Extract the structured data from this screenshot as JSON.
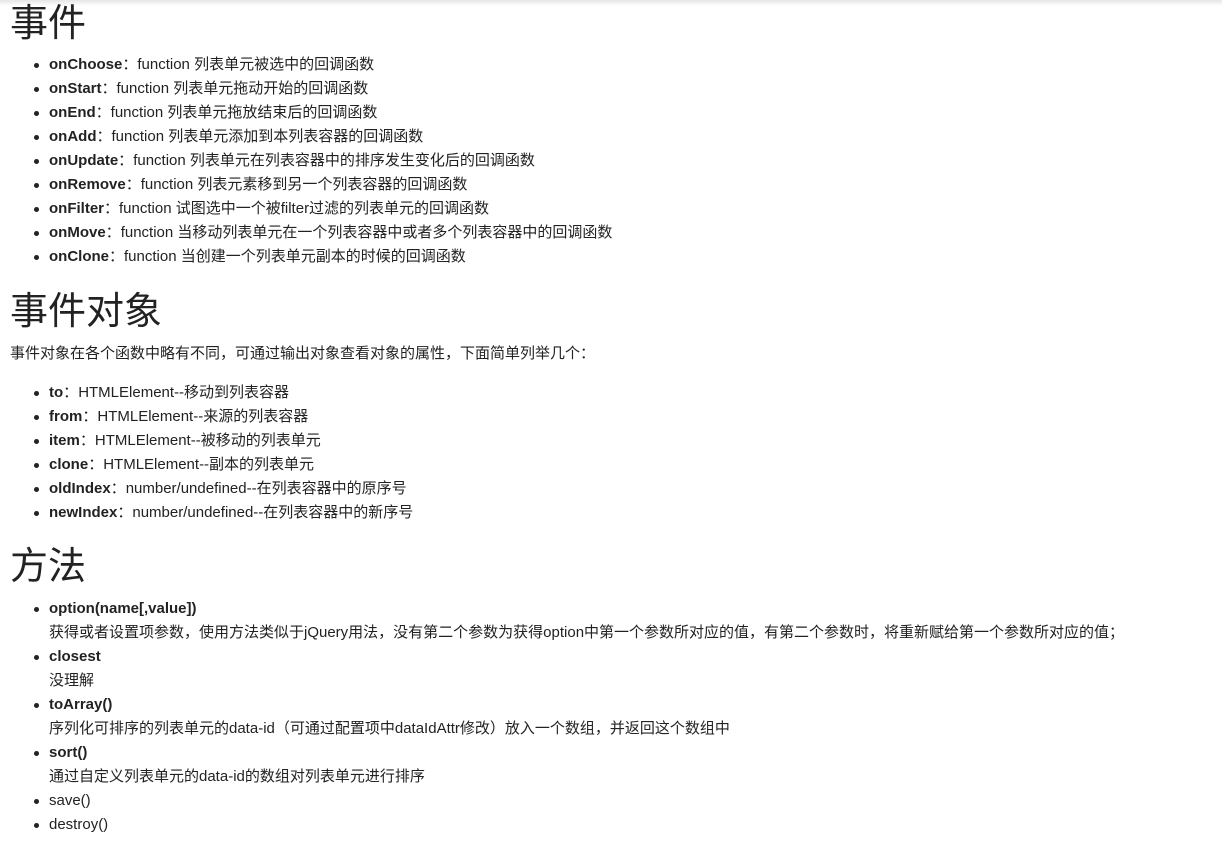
{
  "events": {
    "heading": "事件",
    "items": [
      {
        "name": "onChoose",
        "sep": "：",
        "desc": "function 列表单元被选中的回调函数"
      },
      {
        "name": "onStart",
        "sep": "：",
        "desc": "function 列表单元拖动开始的回调函数"
      },
      {
        "name": "onEnd",
        "sep": "：",
        "desc": "function 列表单元拖放结束后的回调函数"
      },
      {
        "name": "onAdd",
        "sep": "：",
        "desc": "function 列表单元添加到本列表容器的回调函数"
      },
      {
        "name": "onUpdate",
        "sep": "：",
        "desc": "function 列表单元在列表容器中的排序发生变化后的回调函数"
      },
      {
        "name": "onRemove",
        "sep": "：",
        "desc": "function 列表元素移到另一个列表容器的回调函数"
      },
      {
        "name": "onFilter",
        "sep": "：",
        "desc": "function 试图选中一个被filter过滤的列表单元的回调函数"
      },
      {
        "name": "onMove",
        "sep": "：",
        "desc": "function 当移动列表单元在一个列表容器中或者多个列表容器中的回调函数"
      },
      {
        "name": "onClone",
        "sep": "：",
        "desc": "function 当创建一个列表单元副本的时候的回调函数"
      }
    ]
  },
  "event_object": {
    "heading": "事件对象",
    "intro": "事件对象在各个函数中略有不同，可通过输出对象查看对象的属性，下面简单列举几个：",
    "items": [
      {
        "name": "to",
        "sep": "：",
        "desc": "HTMLElement--移动到列表容器"
      },
      {
        "name": "from",
        "sep": "：",
        "desc": "HTMLElement--来源的列表容器"
      },
      {
        "name": "item",
        "sep": "：",
        "desc": "HTMLElement--被移动的列表单元"
      },
      {
        "name": "clone",
        "sep": "：",
        "desc": "HTMLElement--副本的列表单元"
      },
      {
        "name": "oldIndex",
        "sep": "：",
        "desc": "number/undefined--在列表容器中的原序号"
      },
      {
        "name": "newIndex",
        "sep": "：",
        "desc": "number/undefined--在列表容器中的新序号"
      }
    ]
  },
  "methods": {
    "heading": "方法",
    "items": [
      {
        "name": "option(name[,value])",
        "desc": "获得或者设置项参数，使用方法类似于jQuery用法，没有第二个参数为获得option中第一个参数所对应的值，有第二个参数时，将重新赋给第一个参数所对应的值；"
      },
      {
        "name": "closest",
        "desc": "没理解"
      },
      {
        "name": "toArray()",
        "desc": "序列化可排序的列表单元的data-id（可通过配置项中dataIdAttr修改）放入一个数组，并返回这个数组中"
      },
      {
        "name": "sort()",
        "desc": "通过自定义列表单元的data-id的数组对列表单元进行排序"
      },
      {
        "name": "save()"
      },
      {
        "name": "destroy()"
      }
    ]
  }
}
